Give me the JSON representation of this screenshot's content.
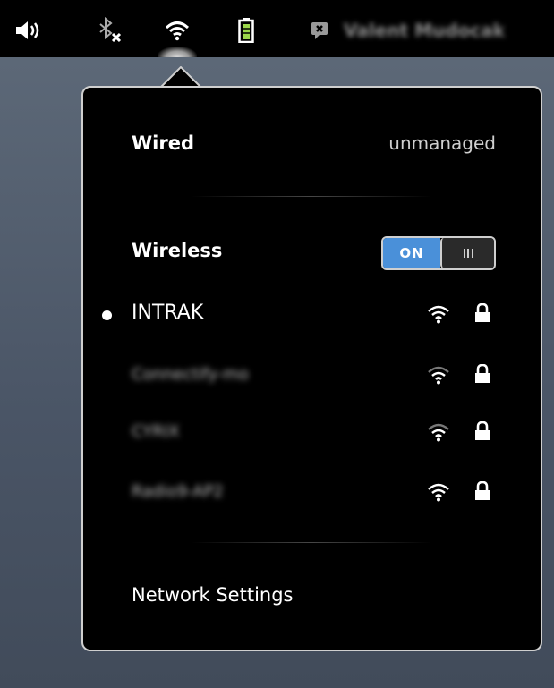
{
  "topbar": {
    "icons": [
      "volume-icon",
      "bluetooth-disabled-icon",
      "wifi-icon",
      "battery-icon",
      "user-status-icon"
    ],
    "user_name": "Valent Mudocak"
  },
  "network_menu": {
    "wired": {
      "label": "Wired",
      "status": "unmanaged"
    },
    "wireless": {
      "label": "Wireless",
      "switch_label": "ON",
      "enabled": true
    },
    "networks": [
      {
        "name": "INTRAK",
        "connected": true,
        "secured": true
      },
      {
        "name": "Connectify-mo",
        "connected": false,
        "secured": true
      },
      {
        "name": "CYRIX",
        "connected": false,
        "secured": true
      },
      {
        "name": "Radio9-AP2",
        "connected": false,
        "secured": true
      }
    ],
    "settings_label": "Network Settings"
  },
  "colors": {
    "accent": "#4a90d9",
    "menu_bg": "#000000",
    "border": "#cfcfcf"
  }
}
